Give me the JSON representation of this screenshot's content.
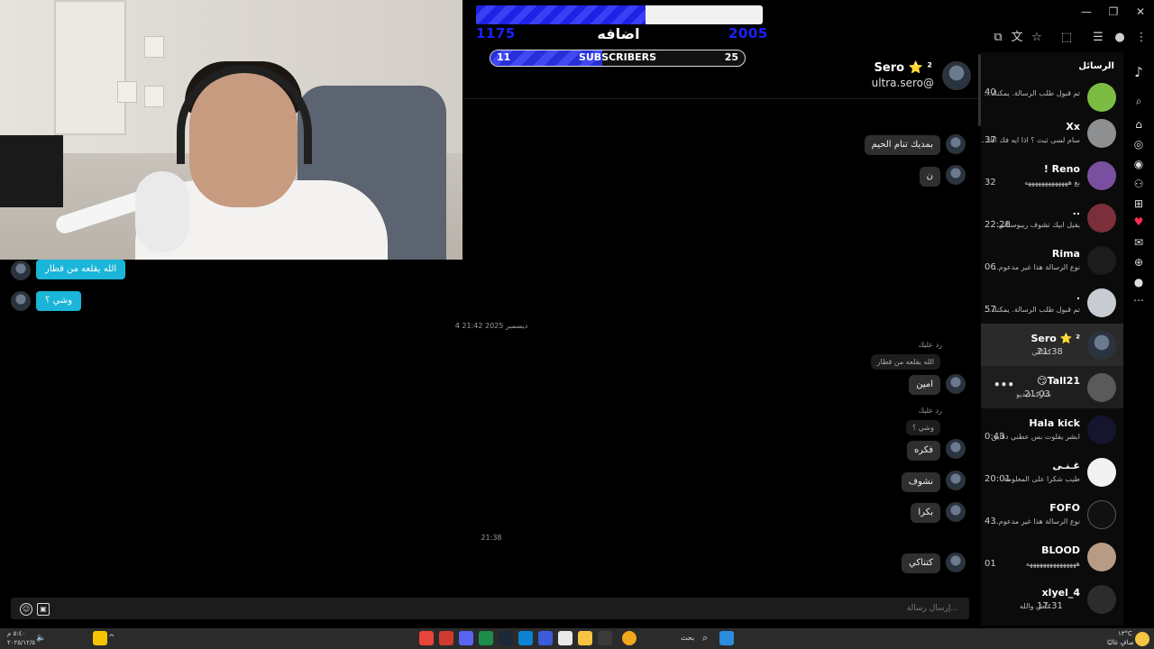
{
  "battle": {
    "title": "اضافه",
    "left_score": "1175",
    "right_score": "2005",
    "progress": 0.59
  },
  "subscribers": {
    "label": "SUBSCRIBERS",
    "current": "11",
    "goal": "25",
    "progress": 0.44
  },
  "chat": {
    "name": "Sero ⭐ ²",
    "handle": "ultra.sero@",
    "date_separator": "4 ديسمبر 2025 21:42",
    "time_separator": "21:38",
    "input_placeholder": "إرسال رسالة..."
  },
  "messages": {
    "left_1": "الله يقلعه من قطار",
    "left_2": "وشي ؟",
    "right_1": "بمديك تنام الحيم",
    "right_2": "ن",
    "reply_note_1": "رد عليك",
    "reply_quote_1": "الله يقلعه من قطار",
    "right_3": "امين",
    "reply_note_2": "رد عليك",
    "reply_quote_2": "وشي ؟",
    "right_4": "فكره",
    "right_5": "نشوف",
    "right_6": "بكرا",
    "right_7": "كتناكي"
  },
  "sidebar": {
    "title": "الرسائل",
    "conversations": [
      {
        "name": "",
        "preview": "تم قبول طلب الرسالة. يمكنك...",
        "time": "40"
      },
      {
        "name": "Xx",
        "preview": "سام لسى ثبث ؟ اذا ايه فك الك...",
        "time": "37"
      },
      {
        "name": "! Reno",
        "preview": "بغ هههههههههههههه",
        "time": "32"
      },
      {
        "name": "..",
        "preview": "يقيل ابيك تشوف ريبوستاتي",
        "time": "22:28"
      },
      {
        "name": "Rima",
        "preview": "نوع الرسالة هذا غير مدعوم...",
        "time": "06"
      },
      {
        "name": ".",
        "preview": "تم قبول طلب الرسالة. يمكنك...",
        "time": "57"
      },
      {
        "name": "Sero ⭐ ²",
        "preview": "كنتاكي",
        "time": "21:38"
      },
      {
        "name": "😏Tall21",
        "preview": "شارك فيديو",
        "time": "21:03"
      },
      {
        "name": "Hala kick",
        "preview": "ابشر يقلوت بس عطني دقايق",
        "time": "0:43"
      },
      {
        "name": "غـنـى",
        "preview": "طيب شكرا على المعلومة",
        "time": "20:01"
      },
      {
        "name": "FOFO",
        "preview": "نوع الرسالة هذا غير مدعوم...",
        "time": "43"
      },
      {
        "name": "BLOOD",
        "preview": "هههههههههههههههه",
        "time": "01"
      },
      {
        "name": "xlyel_4",
        "preview": "عاش والله",
        "time": "17:31"
      }
    ]
  },
  "taskbar": {
    "search_label": "بحث",
    "clock_time": "٥:٤٠ م",
    "clock_date": "٢٠٢٥/١٢/٥",
    "weather": "١٣°C",
    "weather_desc": "صافٍ غالبًا"
  },
  "colors": {
    "accent_blue": "#1a22ff",
    "bubble_cyan": "#1ab5d8"
  }
}
